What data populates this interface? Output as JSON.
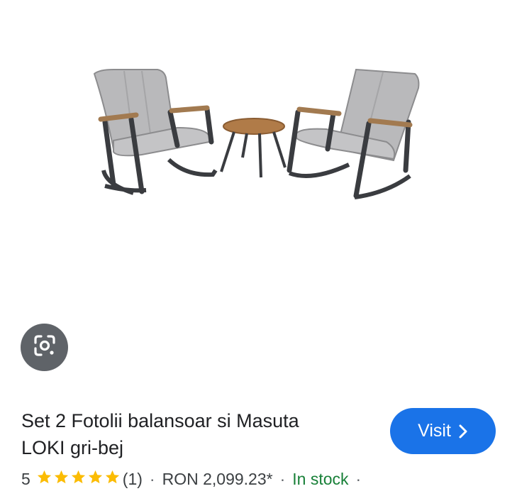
{
  "product": {
    "title_line1": "Set 2 Fotolii balansoar si Masuta",
    "title_line2": "LOKI gri-bej",
    "rating": "5",
    "stars_filled": 5,
    "review_count": "(1)",
    "separator": "·",
    "price": "RON 2,099.23*",
    "stock": "In stock"
  },
  "visit_button": {
    "label": "Visit",
    "icon": "chevron-right-icon"
  },
  "lens_button": {
    "icon": "google-lens-icon"
  },
  "colors": {
    "visit_bg": "#1a73e8",
    "star": "#fbbc04",
    "in_stock": "#188038",
    "lens_bg": "#5f6368"
  }
}
